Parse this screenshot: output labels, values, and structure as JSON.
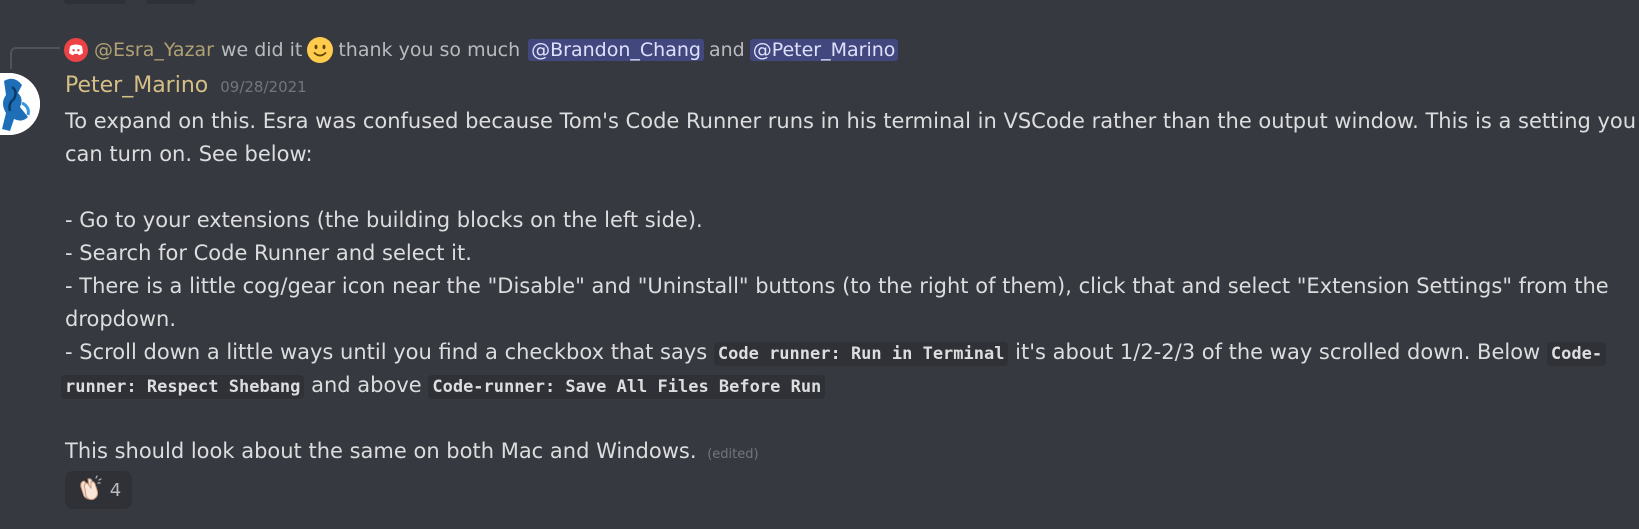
{
  "reply": {
    "user": "@Esra_Yazar",
    "text_before": "we did it",
    "text_middle": "thank you so much",
    "mention_1": "@Brandon_Chang",
    "joiner": "and",
    "mention_2": "@Peter_Marino"
  },
  "message": {
    "username": "Peter_Marino",
    "timestamp": "09/28/2021",
    "lines": {
      "l1": "To expand on this. Esra was confused because Tom's Code Runner runs in his terminal in VSCode rather than the output window. This is a setting you",
      "l2": "can turn on. See below:",
      "l3": "- Go to your extensions (the building blocks on the left side).",
      "l4": "- Search for Code Runner and select it.",
      "l5": "- There is a little cog/gear icon near the \"Disable\" and \"Uninstall\" buttons (to the right of them), click that and select \"Extension Settings\" from the",
      "l6": "dropdown.",
      "l7_a": "- Scroll down a little ways until you find a checkbox that says",
      "l7_code1": "Code runner: Run in Terminal",
      "l7_b": "it's about 1/2-2/3 of the way scrolled down. Below",
      "l7_code2": "Code-",
      "l8_code2": "runner: Respect Shebang",
      "l8_a": "and above",
      "l8_code3": "Code-runner: Save All Files Before Run",
      "l9": "This should look about the same on both Mac and Windows.",
      "edited": "(edited)"
    }
  },
  "reaction": {
    "emoji": "clapping-hands-icon",
    "count": "4"
  },
  "colors": {
    "background": "#36393f",
    "username": "#d6bf87",
    "mention_bg": "#4752c4",
    "code_bg": "#2f3136"
  }
}
